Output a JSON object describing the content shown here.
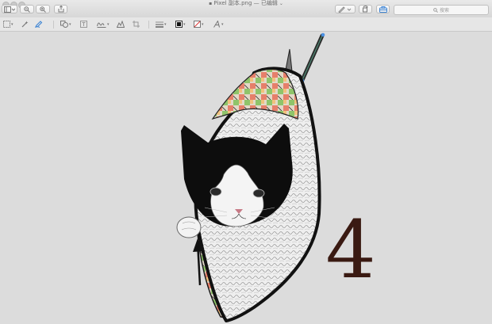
{
  "window": {
    "title_filename": "Pixel 副本.png",
    "title_status": "— 已编辑"
  },
  "toolbar": {
    "sidebar_toggle_icon": "sidebar-icon",
    "zoom_out_icon": "zoom-out-icon",
    "zoom_in_icon": "zoom-in-icon",
    "share_icon": "share-icon",
    "markup_pen_icon": "pen-icon",
    "rotate_icon": "rotate-icon",
    "toolbox_icon": "toolbox-icon",
    "search_placeholder": "搜索"
  },
  "markup_toolbar": {
    "tools": [
      {
        "name": "selection",
        "icon": "rect-selection-icon"
      },
      {
        "name": "instant-alpha",
        "icon": "magic-wand-icon"
      },
      {
        "name": "sketch",
        "icon": "sketch-pen-icon",
        "active": true
      },
      {
        "name": "shapes",
        "icon": "shapes-icon"
      },
      {
        "name": "text",
        "icon": "text-box-icon"
      },
      {
        "name": "sign",
        "icon": "signature-icon"
      },
      {
        "name": "adjust-color",
        "icon": "adjust-color-icon"
      },
      {
        "name": "crop",
        "icon": "crop-icon"
      },
      {
        "name": "line-style",
        "icon": "line-style-icon"
      },
      {
        "name": "border-color",
        "icon": "border-color-icon"
      },
      {
        "name": "fill-color",
        "icon": "fill-color-icon"
      },
      {
        "name": "text-style",
        "icon": "text-style-icon"
      }
    ]
  },
  "canvas": {
    "overlay_text": "4",
    "overlay_color": "#3a1a12",
    "background": "#dcdcdc"
  }
}
